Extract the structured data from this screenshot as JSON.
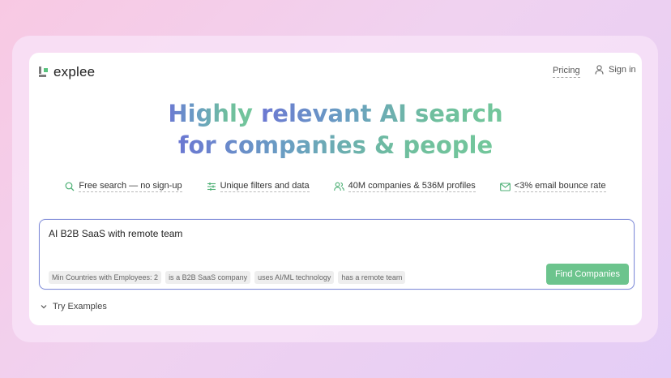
{
  "header": {
    "logo_text": "explee",
    "pricing_label": "Pricing",
    "signin_label": "Sign in"
  },
  "hero": {
    "line1_part1": "Highly",
    "line1_part2": "relevant AI search",
    "line2": "for companies & people"
  },
  "features": [
    {
      "icon": "search-icon",
      "label": "Free search — no sign-up"
    },
    {
      "icon": "sliders-icon",
      "label": "Unique filters and data"
    },
    {
      "icon": "users-icon",
      "label": "40M companies & 536M profiles"
    },
    {
      "icon": "mail-icon",
      "label": "<3% email bounce rate"
    }
  ],
  "search": {
    "query": "AI B2B SaaS with remote team",
    "chips": [
      "Min Countries with Employees: 2",
      "is a B2B SaaS company",
      "uses AI/ML technology",
      "has a remote team"
    ],
    "button_label": "Find Companies"
  },
  "examples": {
    "label": "Try Examples"
  },
  "colors": {
    "accent_green": "#6cc48d",
    "search_border": "#7f8bd8",
    "headline_gradient_start": "#6b78d2",
    "headline_gradient_end": "#73c79b"
  }
}
